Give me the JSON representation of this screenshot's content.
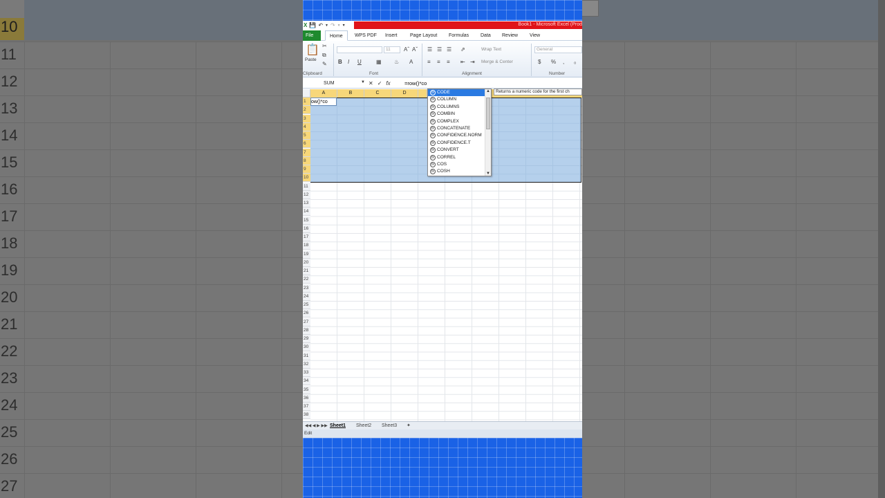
{
  "background": {
    "row_numbers": [
      "10",
      "11",
      "12",
      "13",
      "14",
      "15",
      "16",
      "17",
      "18",
      "19",
      "20",
      "21",
      "22",
      "23",
      "24",
      "25",
      "26",
      "27"
    ]
  },
  "titlebar": {
    "title": "Book1 - Microsoft Excel (Prod"
  },
  "ribbon_tabs": {
    "file": "File",
    "home": "Home",
    "wps_pdf": "WPS PDF",
    "insert": "Insert",
    "page_layout": "Page Layout",
    "formulas": "Formulas",
    "data": "Data",
    "review": "Review",
    "view": "View"
  },
  "ribbon": {
    "paste_label": "Paste",
    "font_size": "11",
    "wrap_text": "Wrap Text",
    "merge_center": "Merge & Center",
    "number_format": "General",
    "group_clipboard": "Clipboard",
    "group_font": "Font",
    "group_alignment": "Alignment",
    "group_number": "Number"
  },
  "formula_bar": {
    "name_box": "SUM",
    "formula": "=row()*co"
  },
  "grid": {
    "columns": [
      "A",
      "B",
      "C",
      "D"
    ],
    "rows": [
      "1",
      "2",
      "3",
      "4",
      "5",
      "6",
      "7",
      "8",
      "9",
      "10",
      "11",
      "12",
      "13",
      "14",
      "15",
      "16",
      "17",
      "18",
      "19",
      "20",
      "21",
      "22",
      "23",
      "24",
      "25",
      "26",
      "27",
      "28",
      "29",
      "30",
      "31",
      "32",
      "33",
      "34",
      "35",
      "36",
      "37",
      "38"
    ],
    "active_cell_text": "ow()*co"
  },
  "autocomplete": {
    "items": [
      "CODE",
      "COLUMN",
      "COLUMNS",
      "COMBIN",
      "COMPLEX",
      "CONCATENATE",
      "CONFIDENCE.NORM",
      "CONFIDENCE.T",
      "CONVERT",
      "CORREL",
      "COS",
      "COSH"
    ],
    "tooltip": "Returns a numeric code for the first ch"
  },
  "sheet_tabs": [
    "Sheet1",
    "Sheet2",
    "Sheet3"
  ],
  "status": {
    "mode": "Edit"
  },
  "colors": {
    "accent_blue": "#1a62e6",
    "title_red": "#e0141a",
    "file_green": "#1e8a2e",
    "selection": "#78aadc",
    "header_highlight": "#f7d77a"
  }
}
